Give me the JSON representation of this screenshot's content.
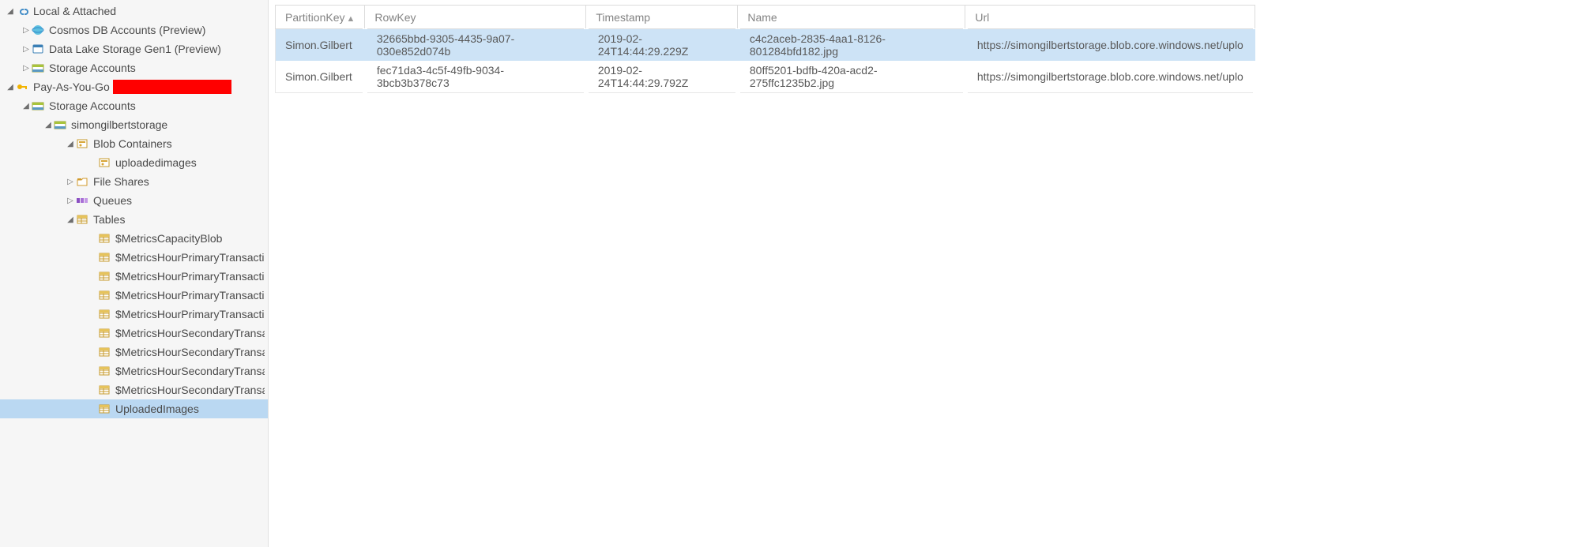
{
  "tree": {
    "local_attached": "Local & Attached",
    "cosmos": "Cosmos DB Accounts (Preview)",
    "datalake": "Data Lake Storage Gen1 (Preview)",
    "storage_accounts_top": "Storage Accounts",
    "payg": "Pay-As-You-Go",
    "storage_accounts_sub": "Storage Accounts",
    "account": "simongilbertstorage",
    "blob_containers": "Blob Containers",
    "uploadedimages_c": "uploadedimages",
    "file_shares": "File Shares",
    "queues": "Queues",
    "tables": "Tables",
    "t0": "$MetricsCapacityBlob",
    "t1": "$MetricsHourPrimaryTransactionsBlob",
    "t2": "$MetricsHourPrimaryTransactionsFile",
    "t3": "$MetricsHourPrimaryTransactionsQueue",
    "t4": "$MetricsHourPrimaryTransactionsTable",
    "t5": "$MetricsHourSecondaryTransactionsBlob",
    "t6": "$MetricsHourSecondaryTransactionsFile",
    "t7": "$MetricsHourSecondaryTransactionsQueue",
    "t8": "$MetricsHourSecondaryTransactionsTable",
    "t9": "UploadedImages"
  },
  "columns": {
    "pk": "PartitionKey",
    "rk": "RowKey",
    "ts": "Timestamp",
    "nm": "Name",
    "url": "Url"
  },
  "rows": [
    {
      "pk": "Simon.Gilbert",
      "rk": "32665bbd-9305-4435-9a07-030e852d074b",
      "ts": "2019-02-24T14:44:29.229Z",
      "nm": "c4c2aceb-2835-4aa1-8126-801284bfd182.jpg",
      "url": "https://simongilbertstorage.blob.core.windows.net/uplo"
    },
    {
      "pk": "Simon.Gilbert",
      "rk": "fec71da3-4c5f-49fb-9034-3bcb3b378c73",
      "ts": "2019-02-24T14:44:29.792Z",
      "nm": "80ff5201-bdfb-420a-acd2-275ffc1235b2.jpg",
      "url": "https://simongilbertstorage.blob.core.windows.net/uplo"
    }
  ]
}
